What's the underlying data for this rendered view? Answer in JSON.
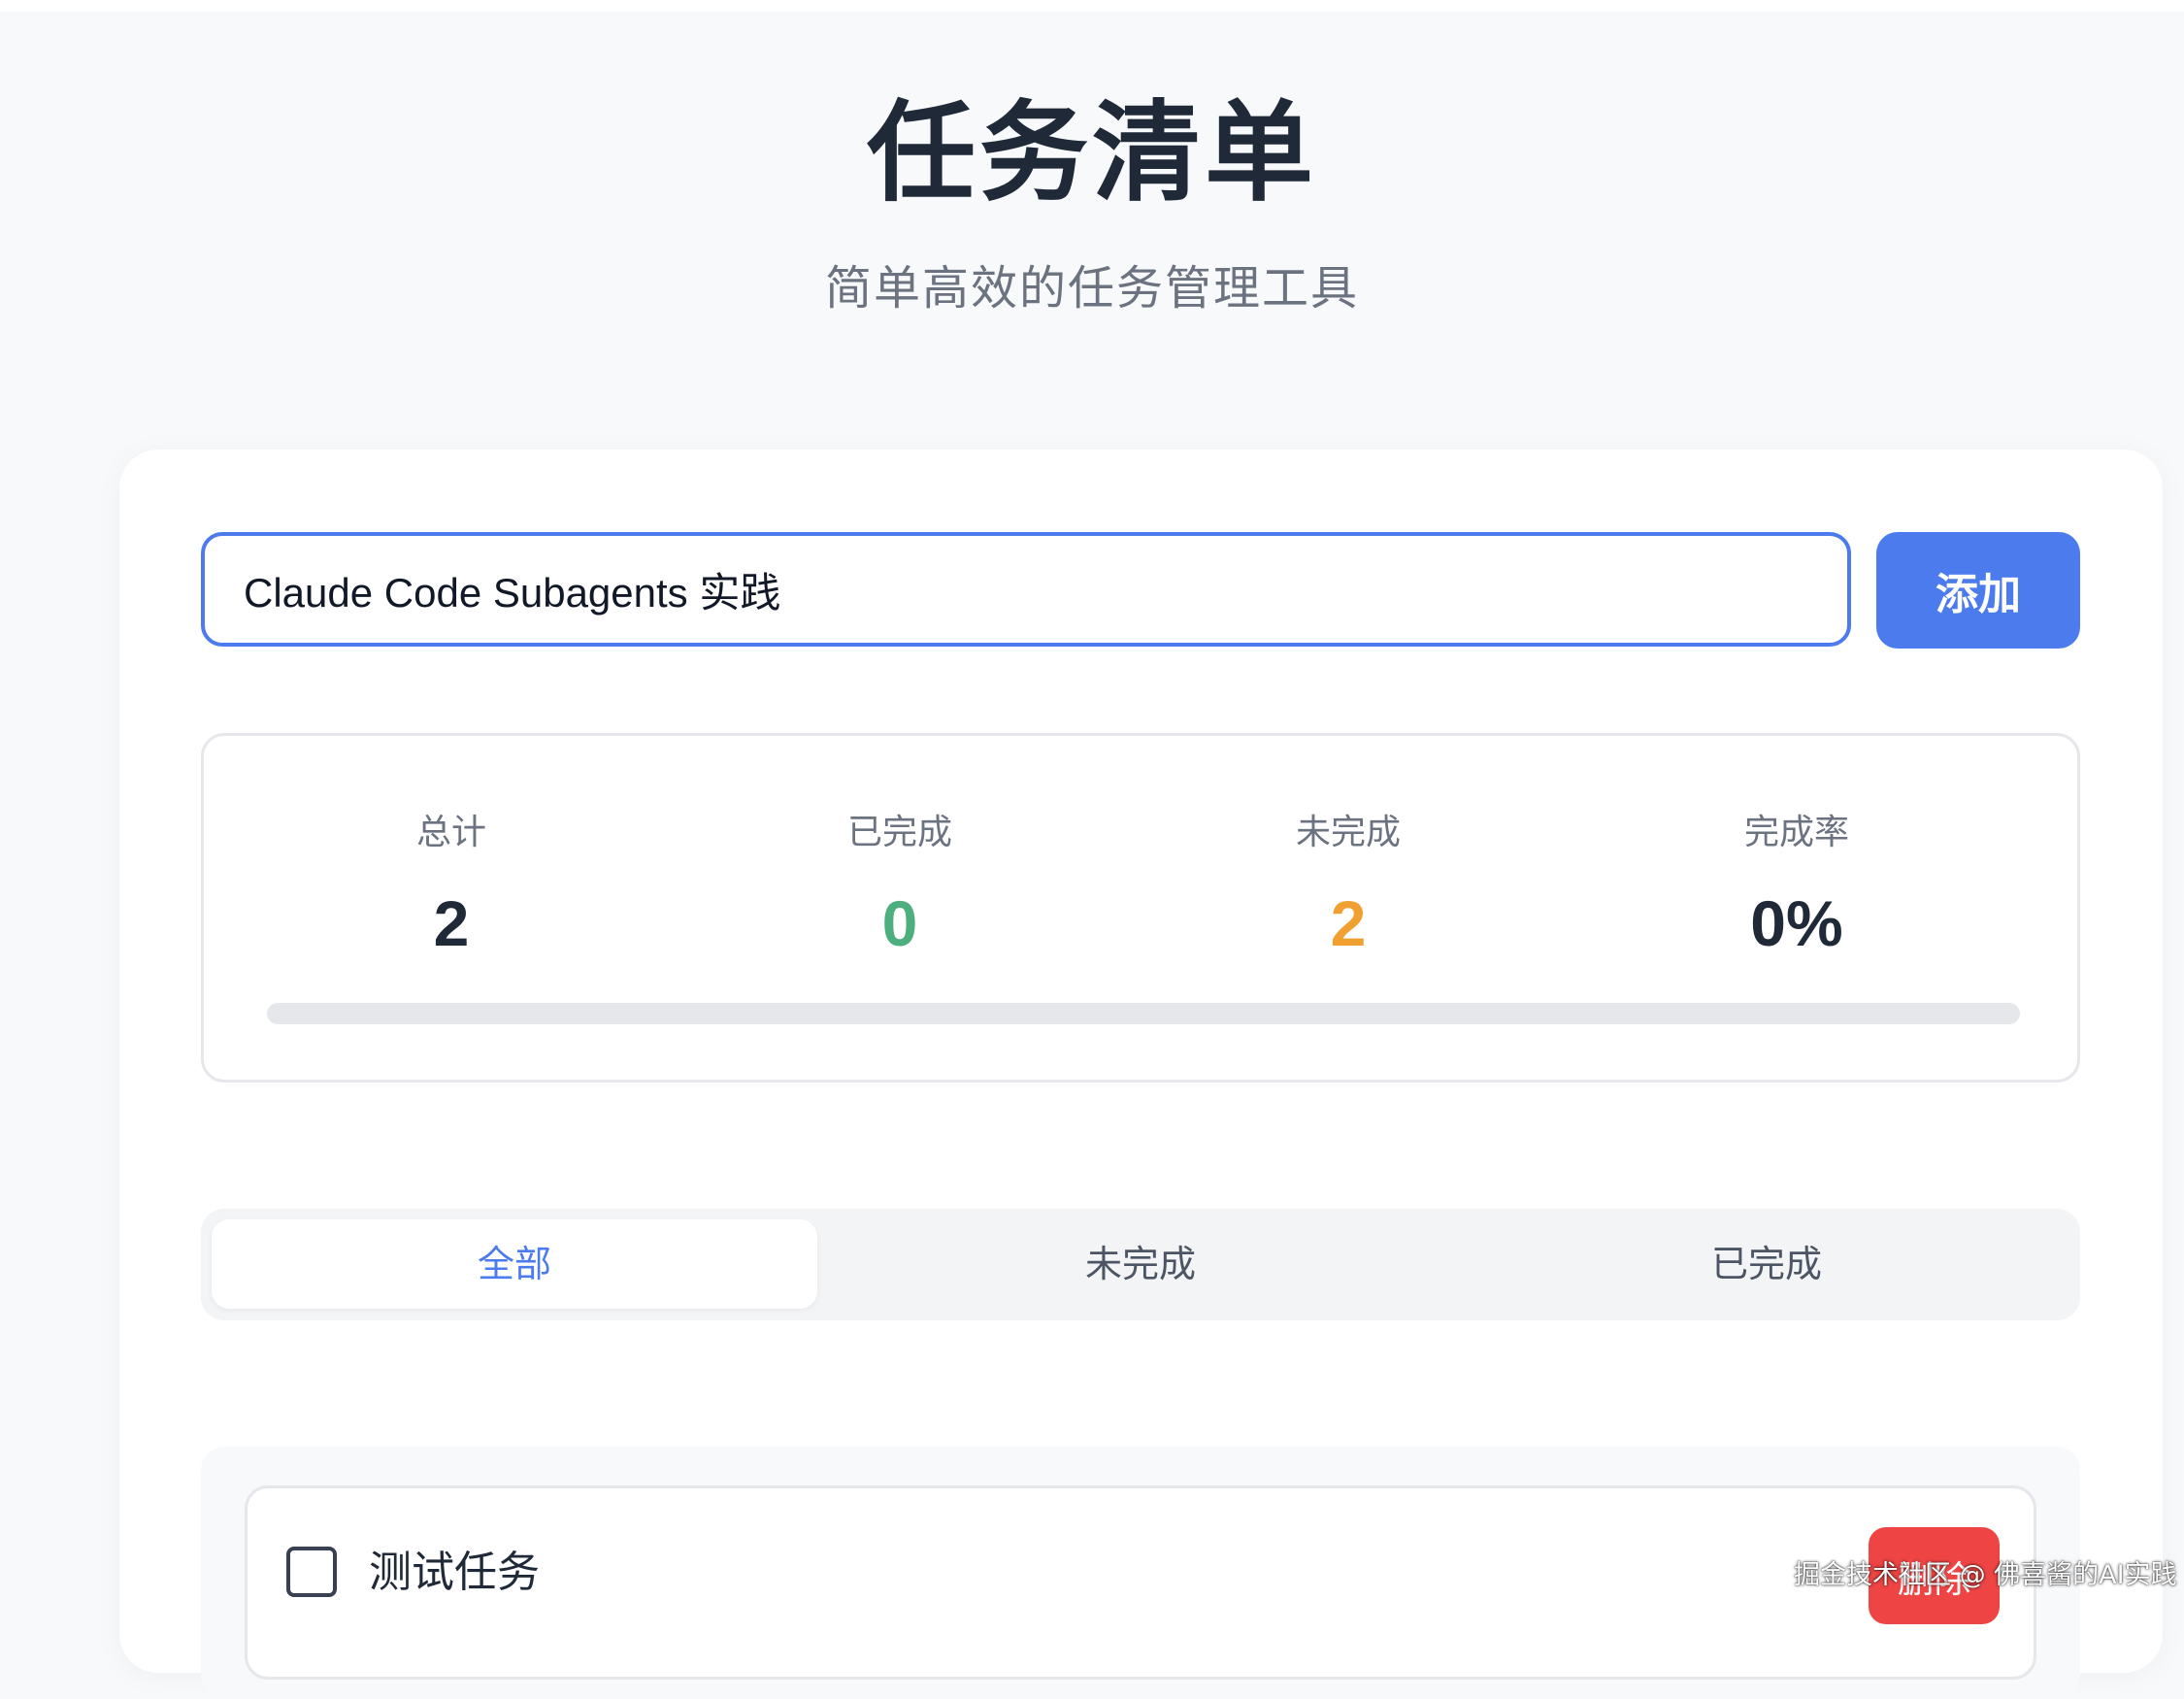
{
  "header": {
    "title": "任务清单",
    "subtitle": "简单高效的任务管理工具"
  },
  "input": {
    "value": "Claude Code Subagents 实践",
    "add_label": "添加"
  },
  "stats": {
    "total_label": "总计",
    "total_value": "2",
    "done_label": "已完成",
    "done_value": "0",
    "pending_label": "未完成",
    "pending_value": "2",
    "rate_label": "完成率",
    "rate_value": "0%",
    "progress_fraction": 0
  },
  "filters": {
    "all": "全部",
    "pending": "未完成",
    "done": "已完成",
    "active": "all"
  },
  "tasks": [
    {
      "title": "测试任务",
      "completed": false,
      "delete_label": "删除"
    }
  ],
  "watermark": "掘金技术社区 @ 佛喜酱的AI实践",
  "colors": {
    "primary": "#4b7bec",
    "done": "#4caf7d",
    "pending": "#f0a030",
    "danger": "#ef4444"
  }
}
